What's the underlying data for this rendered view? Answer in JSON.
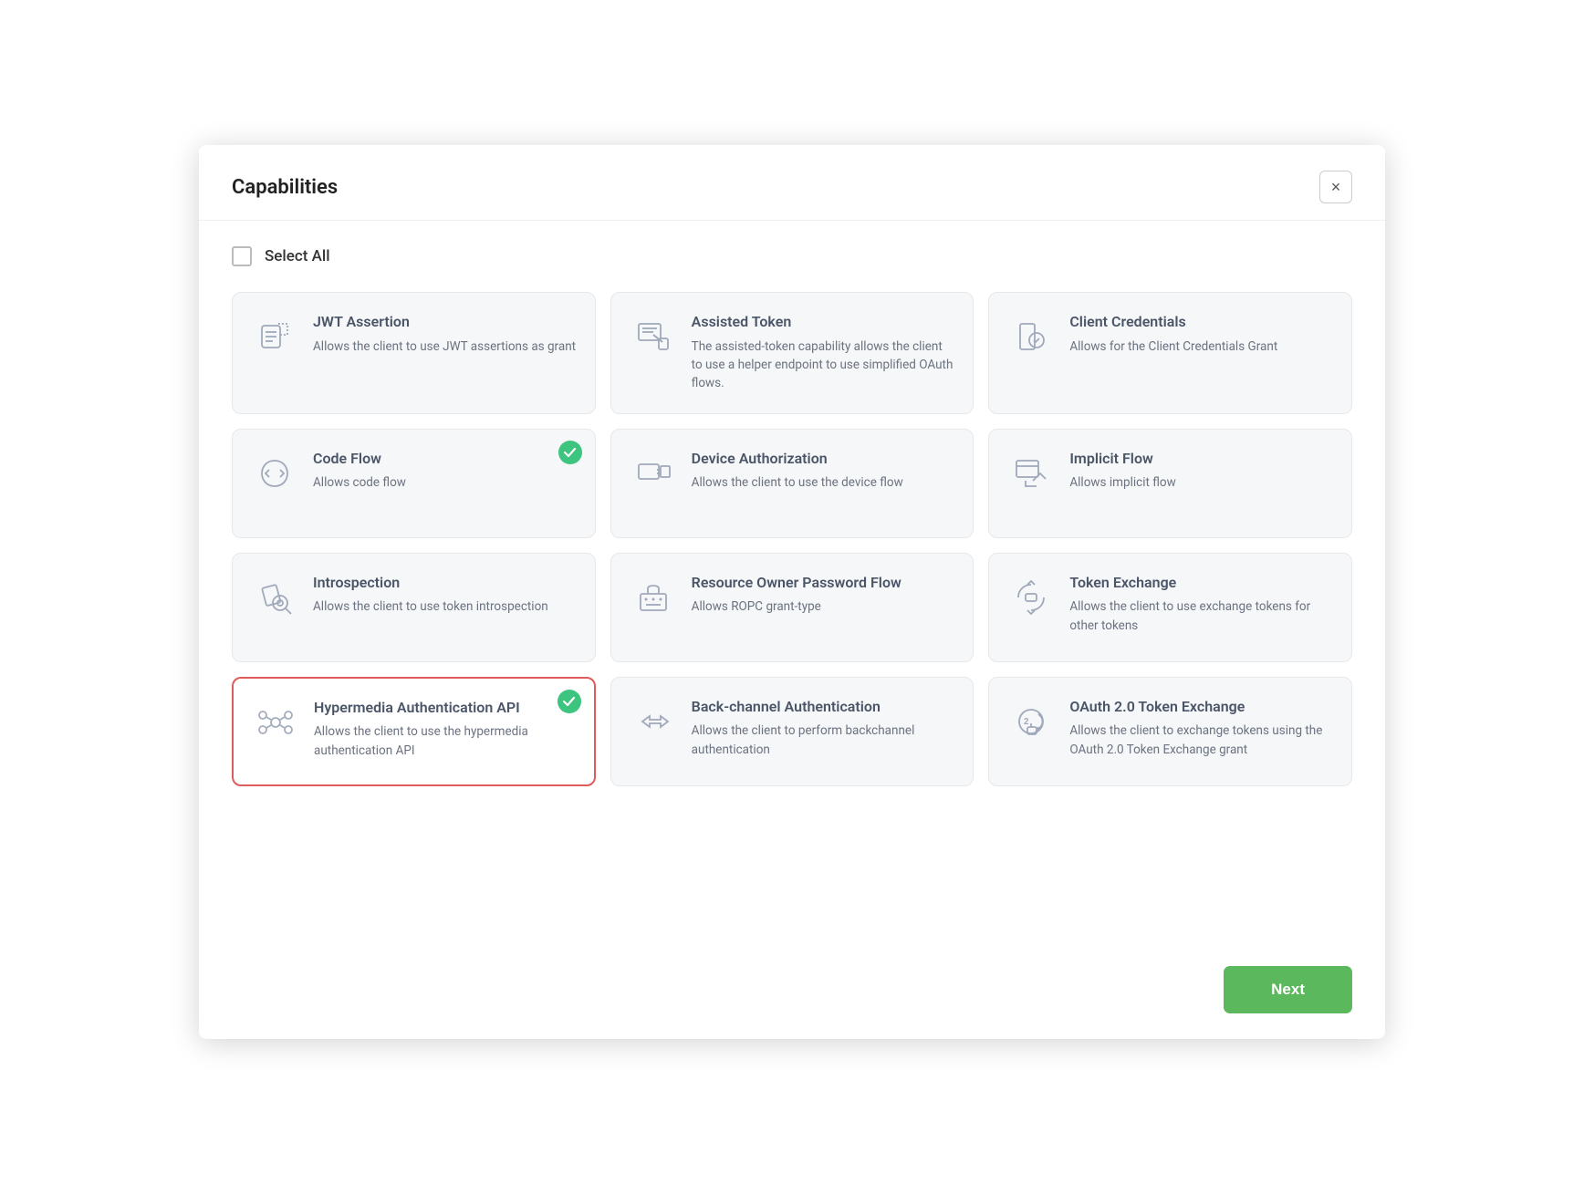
{
  "dialog": {
    "title": "Capabilities",
    "close_label": "×",
    "select_all_label": "Select All",
    "next_label": "Next"
  },
  "capabilities": [
    {
      "id": "jwt-assertion",
      "title": "JWT Assertion",
      "desc": "Allows the client to use JWT assertions as grant",
      "selected": false,
      "icon": "jwt"
    },
    {
      "id": "assisted-token",
      "title": "Assisted Token",
      "desc": "The assisted-token capability allows the client to use a helper endpoint to use simplified OAuth flows.",
      "selected": false,
      "icon": "assisted"
    },
    {
      "id": "client-credentials",
      "title": "Client Credentials",
      "desc": "Allows for the Client Credentials Grant",
      "selected": false,
      "icon": "client-cred"
    },
    {
      "id": "code-flow",
      "title": "Code Flow",
      "desc": "Allows code flow",
      "selected": true,
      "icon": "code-flow"
    },
    {
      "id": "device-authorization",
      "title": "Device Authorization",
      "desc": "Allows the client to use the device flow",
      "selected": false,
      "icon": "device"
    },
    {
      "id": "implicit-flow",
      "title": "Implicit Flow",
      "desc": "Allows implicit flow",
      "selected": false,
      "icon": "implicit"
    },
    {
      "id": "introspection",
      "title": "Introspection",
      "desc": "Allows the client to use token introspection",
      "selected": false,
      "icon": "introspection"
    },
    {
      "id": "resource-owner",
      "title": "Resource Owner Password Flow",
      "desc": "Allows ROPC grant-type",
      "selected": false,
      "icon": "ropc"
    },
    {
      "id": "token-exchange",
      "title": "Token Exchange",
      "desc": "Allows the client to use exchange tokens for other tokens",
      "selected": false,
      "icon": "token-exchange"
    },
    {
      "id": "hypermedia-auth",
      "title": "Hypermedia Authentication API",
      "desc": "Allows the client to use the hypermedia authentication API",
      "selected": true,
      "highlighted": true,
      "icon": "hypermedia"
    },
    {
      "id": "back-channel",
      "title": "Back-channel Authentication",
      "desc": "Allows the client to perform backchannel authentication",
      "selected": false,
      "icon": "backchannel"
    },
    {
      "id": "oauth-token-exchange",
      "title": "OAuth 2.0 Token Exchange",
      "desc": "Allows the client to exchange tokens using the OAuth 2.0 Token Exchange grant",
      "selected": false,
      "icon": "oauth-exchange"
    }
  ]
}
